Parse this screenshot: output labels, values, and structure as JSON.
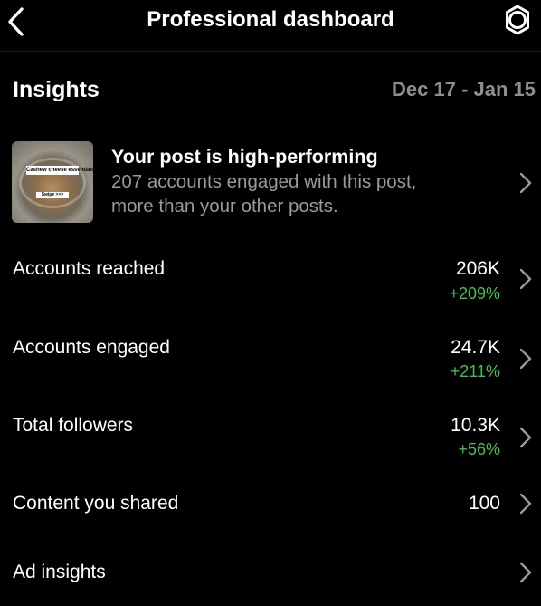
{
  "header": {
    "title": "Professional dashboard",
    "back_icon": "chevron-left-icon",
    "settings_icon": "gear-icon"
  },
  "insights": {
    "title": "Insights",
    "date_range": "Dec 17 - Jan 15"
  },
  "top_post": {
    "title": "Your post is high-performing",
    "description_line1": "207 accounts engaged with this post,",
    "description_line2": "more than your other posts.",
    "thumbnail_text1": "Cashew cheese essentials",
    "thumbnail_text2": "Swipe >>>"
  },
  "metrics": [
    {
      "label": "Accounts reached",
      "value": "206K",
      "change": "+209%"
    },
    {
      "label": "Accounts engaged",
      "value": "24.7K",
      "change": "+211%"
    },
    {
      "label": "Total followers",
      "value": "10.3K",
      "change": "+56%"
    },
    {
      "label": "Content you shared",
      "value": "100",
      "change": ""
    },
    {
      "label": "Ad insights",
      "value": "",
      "change": ""
    }
  ],
  "colors": {
    "background": "#000000",
    "text_primary": "#ffffff",
    "text_secondary": "#8e8e8e",
    "positive_change": "#3fc34f"
  }
}
